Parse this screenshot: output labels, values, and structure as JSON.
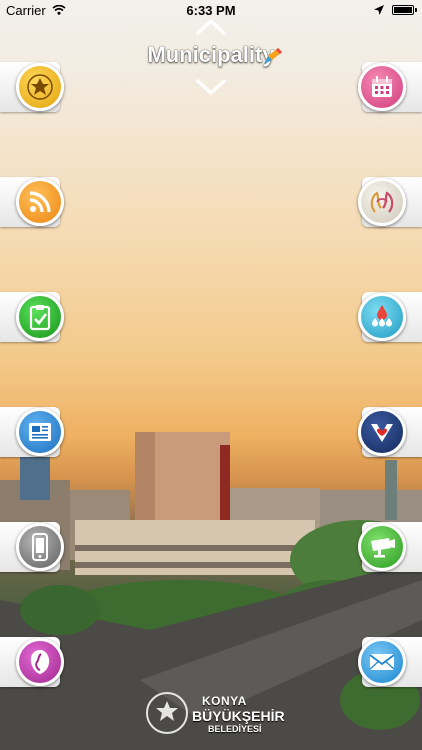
{
  "statusbar": {
    "carrier": "Carrier",
    "time": "6:33 PM"
  },
  "header": {
    "title": "Municipality"
  },
  "left_buttons": [
    {
      "icon": "emblem-icon",
      "color": "#f2b61a"
    },
    {
      "icon": "rss-icon",
      "color": "#f49a1c"
    },
    {
      "icon": "clipboard-check-icon",
      "color": "#2fb52c"
    },
    {
      "icon": "newspaper-icon",
      "color": "#2b8bd6"
    },
    {
      "icon": "phone-icon",
      "color": "#8a8a8a"
    },
    {
      "icon": "map-icon",
      "color": "#c43fb0"
    }
  ],
  "right_buttons": [
    {
      "icon": "calendar-icon",
      "color": "#e35a91"
    },
    {
      "icon": "hands-logo-icon",
      "color": "#e8e4da"
    },
    {
      "icon": "water-icon",
      "color": "#38b8d8"
    },
    {
      "icon": "heart-v-icon",
      "color": "#233a73"
    },
    {
      "icon": "camera-icon",
      "color": "#49b93a"
    },
    {
      "icon": "mail-icon",
      "color": "#35a7e6"
    }
  ],
  "logo": {
    "line1": "KONYA",
    "line2": "BÜYÜKŞEHİR",
    "line3": "BELEDİYESİ"
  }
}
